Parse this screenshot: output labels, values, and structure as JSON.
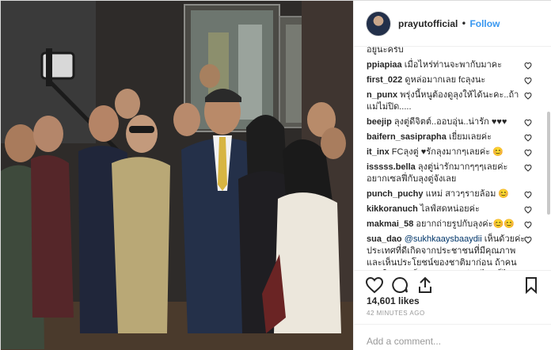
{
  "post": {
    "username": "prayutofficial",
    "separator": "•",
    "follow_label": "Follow",
    "partial_comment": "อยู่นะครับ",
    "comments": [
      {
        "user": "ppiapiaa",
        "text": "เมื่อไหร่ท่านจะพากับมาคะ"
      },
      {
        "user": "first_022",
        "text": "ดูหล่อมากเลย fcลุงนะ"
      },
      {
        "user": "n_punx",
        "text": "พรุ่งนี้หนูต้องดูลุงให้ได้นะคะ..ถ้าแม่ไม่ปิด....."
      },
      {
        "user": "beejip",
        "text": "ลุงตู่ดีจิตต์..ออบอุ่น..น่ารัก ♥♥♥"
      },
      {
        "user": "baifern_sasiprapha",
        "text": "เยี่ยมเลยค่ะ"
      },
      {
        "user": "it_inx",
        "text": "FCลุงตู่ ♥รักลุงมากๆเลยค่ะ 😊"
      },
      {
        "user": "isssss.bella",
        "text": "ลุงตู่น่ารักมากๆๆๆเลยค่ะ อยากเซลฟี่กับลุงตู่จังเลย"
      },
      {
        "user": "punch_puchy",
        "text": "แหม่ สาวๆรายล้อม 😊"
      },
      {
        "user": "kikkoranuch",
        "text": "ไลฟ์สดหน่อยค่ะ"
      },
      {
        "user": "makmai_58",
        "text": "อยากถ่ายรูปกับลุงค่ะ😊😊"
      },
      {
        "user": "sua_dao",
        "mention": "@sukhkaaysbaaydii",
        "text": "เห็นด้วยค่ะ ประเทศที่ดีเกิดจากประชาชนที่มีคุณภาพ และเห็นประโยชน์ของชาติมาก่อน ถ้าคนส่วนใหญ่ยังเห็นแก่ตัว ผู้นำดีแค่ไหนก็ไม่ช่วยอะไร เลือกตั้งไปก็วังวนเดิมๆ"
      }
    ],
    "likes": "14,601 likes",
    "timestamp": "42 MINUTES AGO",
    "add_comment_placeholder": "Add a comment...",
    "colors": {
      "link": "#3897f0",
      "heart_red": "#ed4956",
      "text": "#262626",
      "muted": "#999999"
    },
    "icons": [
      "like-heart-icon",
      "comment-bubble-icon",
      "share-arrow-icon",
      "bookmark-icon",
      "comment-like-heart-icon"
    ]
  }
}
